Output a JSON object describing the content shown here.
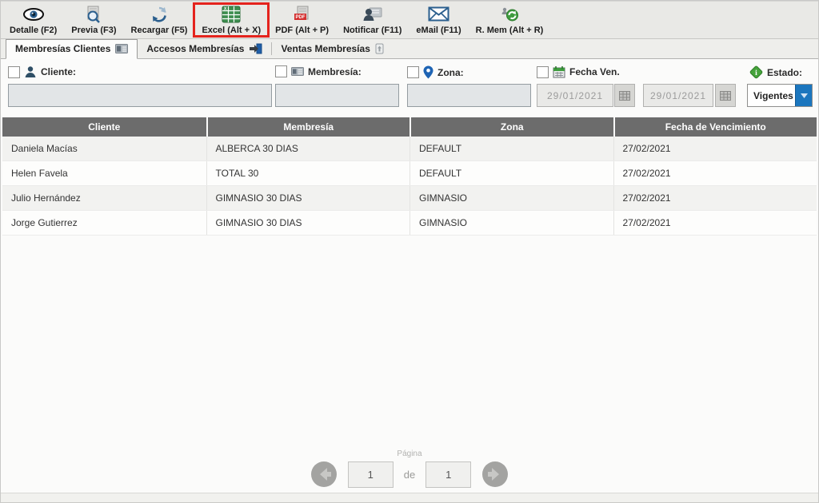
{
  "toolbar": {
    "highlight_color": "#e4231d",
    "buttons": [
      {
        "label": "Detalle (F2)",
        "icon": "eye-icon"
      },
      {
        "label": "Previa (F3)",
        "icon": "preview-icon"
      },
      {
        "label": "Recargar (F5)",
        "icon": "refresh-icon"
      },
      {
        "label": "Excel (Alt + X)",
        "icon": "excel-icon",
        "highlighted": true
      },
      {
        "label": "PDF (Alt + P)",
        "icon": "pdf-icon"
      },
      {
        "label": "Notificar (F11)",
        "icon": "notify-icon"
      },
      {
        "label": "eMail (F11)",
        "icon": "email-icon"
      },
      {
        "label": "R. Mem (Alt + R)",
        "icon": "renew-membership-icon"
      }
    ]
  },
  "tabs": [
    {
      "label": "Membresías Clientes",
      "icon": "id-card-icon",
      "active": true
    },
    {
      "label": "Accesos Membresías",
      "icon": "door-entry-icon",
      "active": false
    },
    {
      "label": "Ventas Membresías",
      "icon": "sales-icon",
      "active": false
    }
  ],
  "filters": {
    "cliente": {
      "label": "Cliente:",
      "icon": "person-icon",
      "checked": false,
      "value": ""
    },
    "membresia": {
      "label": "Membresía:",
      "icon": "id-card-icon",
      "checked": false,
      "value": ""
    },
    "zona": {
      "label": "Zona:",
      "icon": "map-pin-icon",
      "checked": false,
      "value": ""
    },
    "fecha": {
      "label": "Fecha Ven.",
      "icon": "calendar-icon",
      "checked": false,
      "from": "29/01/2021",
      "to": "29/01/2021"
    },
    "estado": {
      "label": "Estado:",
      "icon": "info-icon",
      "value": "Vigentes"
    }
  },
  "table": {
    "columns": [
      "Cliente",
      "Membresía",
      "Zona",
      "Fecha de Vencimiento"
    ],
    "rows": [
      [
        "Daniela Macías",
        "ALBERCA 30 DIAS",
        "DEFAULT",
        "27/02/2021"
      ],
      [
        "Helen Favela",
        "TOTAL 30",
        "DEFAULT",
        "27/02/2021"
      ],
      [
        "Julio Hernández",
        "GIMNASIO 30 DIAS",
        "GIMNASIO",
        "27/02/2021"
      ],
      [
        "Jorge Gutierrez",
        "GIMNASIO 30 DIAS",
        "GIMNASIO",
        "27/02/2021"
      ]
    ]
  },
  "pagination": {
    "label": "Página",
    "current": "1",
    "separator": "de",
    "total": "1"
  }
}
